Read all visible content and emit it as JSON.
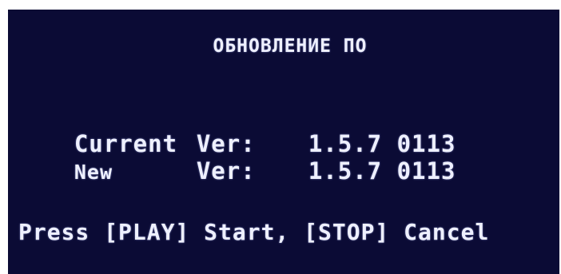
{
  "screen": {
    "title": "ОБНОВЛЕНИЕ ПО",
    "current": {
      "label": "Current",
      "sub_label": "Ver:",
      "value": "1.5.7 0113"
    },
    "new": {
      "label": "New",
      "sub_label": "Ver:",
      "value": "1.5.7 0113"
    },
    "prompt": "Press [PLAY] Start, [STOP] Cancel",
    "background_color": "#0b0b35",
    "text_color": "#eef0ff"
  }
}
